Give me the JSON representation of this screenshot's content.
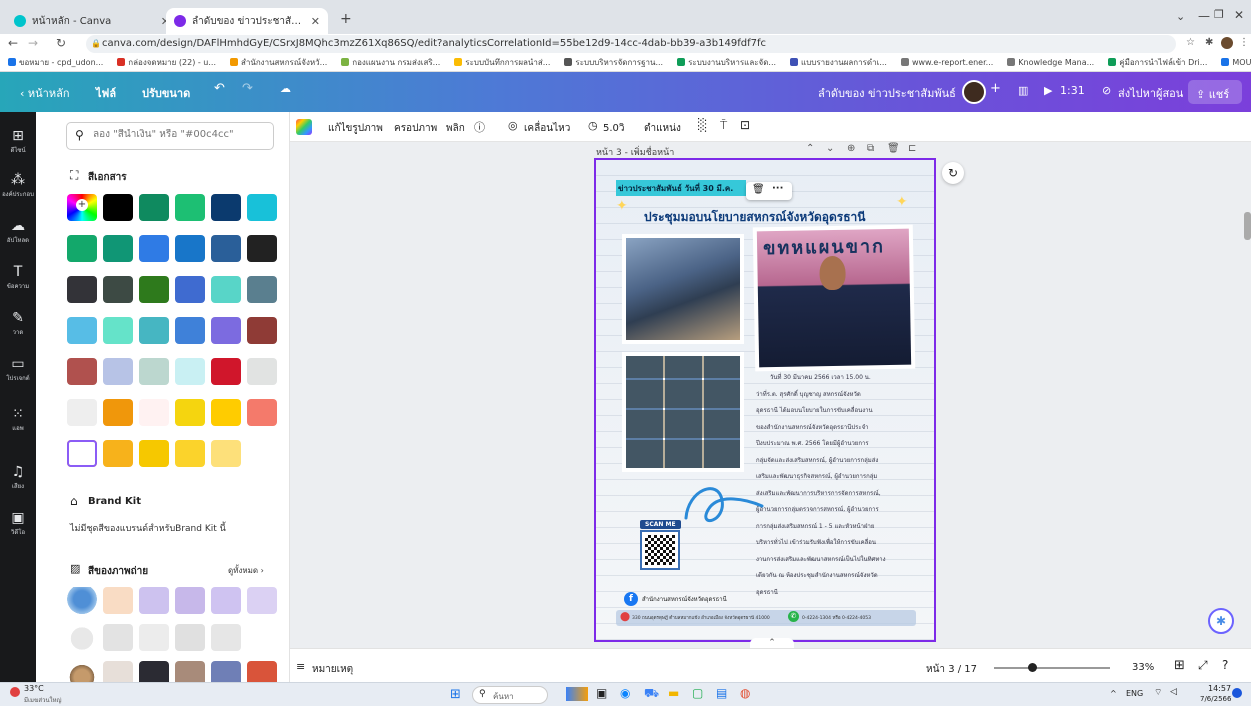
{
  "browser": {
    "tabs": [
      {
        "title": "หน้าหลัก - Canva",
        "active": false
      },
      {
        "title": "ลำดับของ ข่าวประชาสัมพันธ์ - ไม่มีชื่อ",
        "active": true
      }
    ],
    "new_tab": "+",
    "url": "canva.com/design/DAFlHmhdGyE/CSrxJ8MQhc3mzZ61Xq86SQ/edit?analyticsCorrelationId=55be12d9-14cc-4dab-bb39-a3b149fdf7fc",
    "bookmarks": [
      "ขอหมาย - cpd_udon...",
      "กล่องจดหมาย (22) - u...",
      "สำนักงานสหกรณ์จังหวั...",
      "กองแผนงาน กรมส่งเสริ...",
      "ระบบบันทึกการผลนำส่...",
      "ระบบบริหารจัดการฐาน...",
      "ระบบงานบริหารและจัด...",
      "แบบรายงานผลการดำเ...",
      "www.e-report.ener...",
      "Knowledge Mana...",
      "คู่มือการนำไฟล์เข้า Dri...",
      "MOU64_1 - Google..."
    ],
    "bookmarks_more": "»"
  },
  "canva_topbar": {
    "back": "‹ หน้าหลัก",
    "file": "ไฟล์",
    "resize": "ปรับขนาด",
    "design_title": "ลำดับของ ข่าวประชาสัมพันธ์",
    "timer": "1:31",
    "send_to_teacher": "ส่งไปหาผู้สอน",
    "share": "แชร์"
  },
  "side_rail": [
    {
      "label": "ดีไซน์",
      "icon": "layout-icon"
    },
    {
      "label": "องค์ประกอบ",
      "icon": "elements-icon"
    },
    {
      "label": "อัปโหลด",
      "icon": "upload-icon"
    },
    {
      "label": "ข้อความ",
      "icon": "text-icon"
    },
    {
      "label": "วาด",
      "icon": "draw-icon"
    },
    {
      "label": "โปรเจกต์",
      "icon": "folder-icon"
    },
    {
      "label": "แอพ",
      "icon": "apps-icon"
    },
    {
      "label": "เสียง",
      "icon": "audio-icon"
    },
    {
      "label": "วิดีโอ",
      "icon": "video-icon"
    }
  ],
  "color_panel": {
    "search_placeholder": "ลอง \"สีน้ำเงิน\" หรือ \"#00c4cc\"",
    "document_colors_title": "สีเอกสาร",
    "document_colors": [
      "#000000",
      "#0f8a5f",
      "#1dbf73",
      "#0b3a6e",
      "#18c1d9",
      "#13a86b",
      "#109675",
      "#2f7be5",
      "#1876c9",
      "#2a5f99",
      "#222222",
      "#333338",
      "#3d4a44",
      "#2e7a1c",
      "#3f6bd0",
      "#58d5c8",
      "#5a7f8f",
      "#57bde6",
      "#65e3c9",
      "#46b6c2",
      "#3f81d9",
      "#7c6be0",
      "#8f3b36",
      "#b0514e",
      "#b7c3e6",
      "#bcd7cf",
      "#c9f0f3",
      "#d0162b",
      "#e1e3e2",
      "#eeeeee",
      "#f0970b",
      "#fff2f2",
      "#f5d50f",
      "#ffcc00",
      "#f47a6b",
      "#ff9e0f",
      "#f7b21b",
      "#f6c800",
      "#fbd32b",
      "#fde07a"
    ],
    "brand_kit_title": "Brand Kit",
    "brand_kit_message": "ไม่มีชุดสีของแบรนด์สำหรับBrand Kit นี้",
    "photo_colors_title": "สีของภาพถ่าย",
    "see_all": "ดูทั้งหมด ›",
    "photo_colors": [
      "#f9dcc4",
      "#cdc2ef",
      "#c7b8ea",
      "#cfc3f1",
      "#dbd1f3",
      "#e3e3e3",
      "#ececec",
      "#e0e0e0",
      "#e6e6e6",
      "#e7dfd9",
      "#2b2b33",
      "#a88b7a",
      "#6f7fb6",
      "#d9543a"
    ]
  },
  "context_toolbar": {
    "edit_image": "แก้ไขรูปภาพ",
    "crop": "ครอปภาพ",
    "flip": "พลิก",
    "shadow": "เคลื่อนไหว",
    "duration": "5.0วิ",
    "position": "ตำแหน่ง"
  },
  "page_header": "หน้า 3 - เพิ่มชื่อหน้า",
  "poster": {
    "tag": "ข่าวประชาสัมพันธ์ วันที่ 30 มี.ค.",
    "headline": "ประชุมมอบนโยบายสหกรณ์จังหวัดอุดรธานี",
    "sign_text": "ขทหแผนขาก",
    "body_lines": [
      "วันที่ 30 มีนาคม 2566 เวลา 15.00 น.",
      "ว่าที่ร.ต. สุรศักดิ์ บุญชาญ สหกรณ์จังหวัด",
      "อุดรธานี ได้มอบนโยบายในการขับเคลื่อนงาน",
      "ของสำนักงานสหกรณ์จังหวัดอุดรธานีประจำ",
      "ปีงบประมาณ พ.ศ. 2566 โดยมีผู้อำนวยการ",
      "กลุ่มจัดและส่งเสริมสหกรณ์, ผู้อำนวยการกลุ่มส่ง",
      "เสริมและพัฒนาธุรกิจสหกรณ์, ผู้อำนวยการกลุ่ม",
      "ส่งเสริมและพัฒนาการบริหารการจัดการสหกรณ์,",
      "ผู้อำนวยการกลุ่มตรวจการสหกรณ์, ผู้อำนวยการ",
      "การกลุ่มส่งเสริมสหกรณ์ 1 - 5 และหัวหน้าฝ่าย",
      "บริหารทั่วไป เข้าร่วมรับฟังเพื่อให้การขับเคลื่อน",
      "งานการส่งเสริมและพัฒนาสหกรณ์เป็นไปในทิศทาง",
      "เดียวกัน ณ ห้องประชุมสำนักงานสหกรณ์จังหวัด",
      "อุดรธานี"
    ],
    "scan_me": "SCAN ME",
    "facebook_name": "สำนักงานสหกรณ์จังหวัดอุดรธานี",
    "address": "330 ถนนอุดรดุษฎี ตำบลหมากแข้ง อำเภอเมือง จังหวัดอุดรธานี 41000",
    "phone": "0-4224-1304 หรือ 0-4224-4053"
  },
  "bottom_bar": {
    "notes": "หมายเหตุ",
    "page_indicator": "หน้า 3 / 17",
    "zoom": "33%",
    "zoom_level_fraction": 0.33
  },
  "taskbar": {
    "weather_temp": "33°C",
    "weather_desc": "มีเมฆส่วนใหญ่",
    "search": "ค้นหา",
    "lang": "ENG",
    "time": "14:57",
    "date": "7/6/2566"
  },
  "colors": {
    "topbar_gradient_start": "#27a6b9",
    "topbar_gradient_end": "#7b3fdb",
    "rail_bg": "#18191b",
    "selection": "#7d2ae8"
  }
}
